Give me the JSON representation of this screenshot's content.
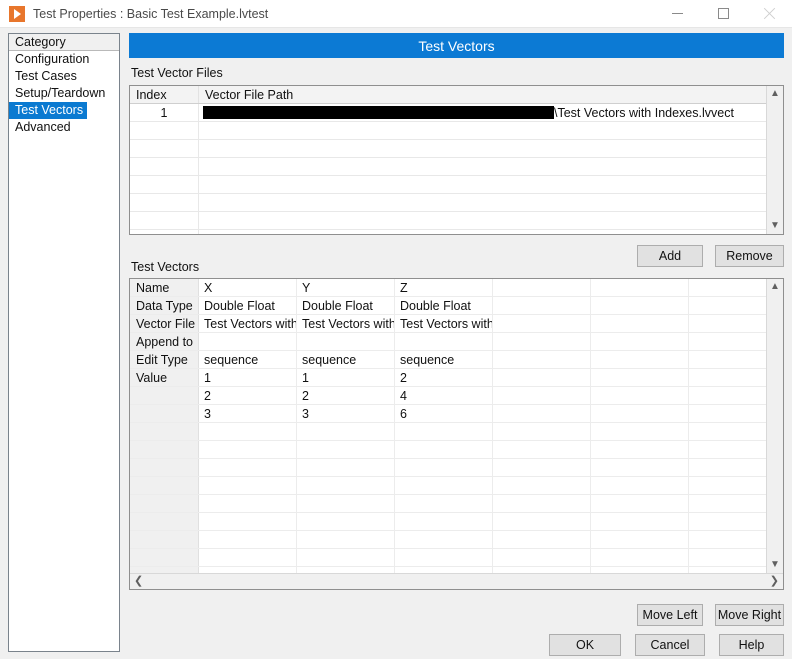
{
  "window": {
    "title": "Test Properties : Basic Test Example.lvtest",
    "app_icon": "play-triangle-icon",
    "controls": {
      "minimize": "minimize-icon",
      "maximize": "maximize-icon",
      "close": "close-icon"
    },
    "accent_color": "#0c7ad4"
  },
  "sidebar": {
    "header": "Category",
    "items": [
      {
        "label": "Configuration",
        "selected": false
      },
      {
        "label": "Test Cases",
        "selected": false
      },
      {
        "label": "Setup/Teardown",
        "selected": false
      },
      {
        "label": "Test Vectors",
        "selected": true
      },
      {
        "label": "Advanced",
        "selected": false
      }
    ],
    "selected_color": "#0b7ad1"
  },
  "panel": {
    "header": "Test Vectors",
    "files_section_label": "Test Vector Files",
    "vectors_section_label": "Test Vectors"
  },
  "files_table": {
    "columns": [
      "Index",
      "Vector File Path"
    ],
    "rows": [
      {
        "index": "1",
        "path_redacted": true,
        "path_tail": "\\Test Vectors with Indexes.lvvect"
      }
    ],
    "empty_row_count": 7,
    "scroll": {
      "up": "▲",
      "down": "▼"
    }
  },
  "vector_grid": {
    "row_labels": [
      "Name",
      "Data Type",
      "Vector File",
      "Append to",
      "Edit Type",
      "Value",
      "",
      ""
    ],
    "columns": [
      {
        "name": "X",
        "data_type": "Double Float",
        "vector_file": "Test Vectors with",
        "append_to": "",
        "edit_type": "sequence",
        "values": [
          "1",
          "2",
          "3"
        ]
      },
      {
        "name": "Y",
        "data_type": "Double Float",
        "vector_file": "Test Vectors with",
        "append_to": "",
        "edit_type": "sequence",
        "values": [
          "1",
          "2",
          "3"
        ]
      },
      {
        "name": "Z",
        "data_type": "Double Float",
        "vector_file": "Test Vectors with I",
        "append_to": "",
        "edit_type": "sequence",
        "values": [
          "2",
          "4",
          "6"
        ]
      },
      {
        "name": "",
        "data_type": "",
        "vector_file": "",
        "append_to": "",
        "edit_type": "",
        "values": [
          "",
          "",
          ""
        ]
      },
      {
        "name": "",
        "data_type": "",
        "vector_file": "",
        "append_to": "",
        "edit_type": "",
        "values": [
          "",
          "",
          ""
        ]
      },
      {
        "name": "",
        "data_type": "",
        "vector_file": "",
        "append_to": "",
        "edit_type": "",
        "values": [
          "",
          "",
          ""
        ]
      },
      {
        "name": "",
        "data_type": "",
        "vector_file": "",
        "append_to": "",
        "edit_type": "",
        "values": [
          "",
          "",
          ""
        ]
      }
    ],
    "empty_row_count": 9,
    "scroll": {
      "up": "▲",
      "down": "▼",
      "left": "❮",
      "right": "❯"
    }
  },
  "buttons": {
    "add": "Add",
    "remove": "Remove",
    "move_left": "Move Left",
    "move_right": "Move Right",
    "ok": "OK",
    "cancel": "Cancel",
    "help": "Help"
  }
}
